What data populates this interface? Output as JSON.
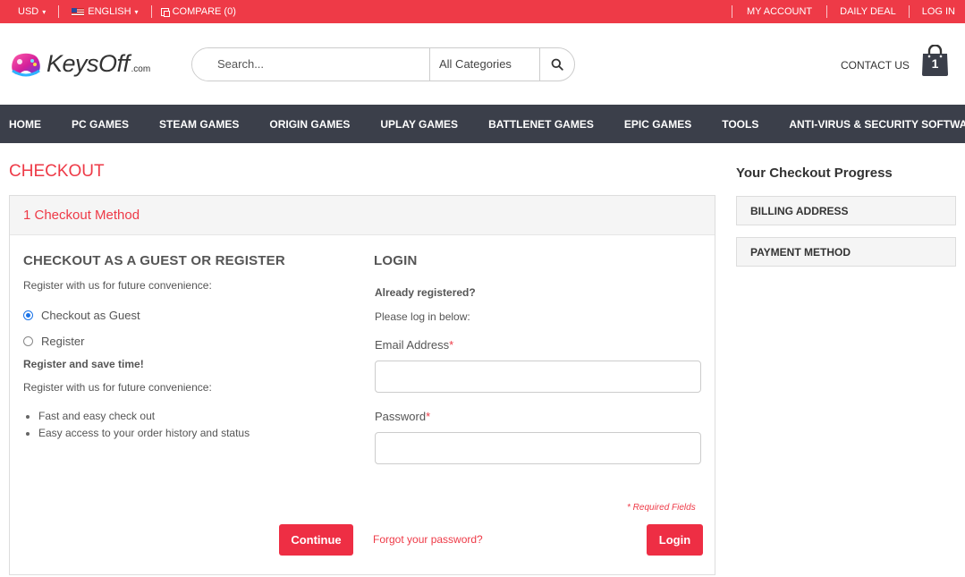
{
  "topbar": {
    "currency": "USD",
    "language": "ENGLISH",
    "compare": "COMPARE (0)",
    "my_account": "MY ACCOUNT",
    "daily_deal": "DAILY DEAL",
    "login": "LOG IN"
  },
  "header": {
    "logo_text": "KeysOff",
    "logo_suffix": ".com",
    "search_placeholder": "Search...",
    "search_category": "All Categories",
    "contact": "CONTACT US",
    "cart_count": "1"
  },
  "nav": {
    "items": [
      "HOME",
      "PC GAMES",
      "STEAM GAMES",
      "ORIGIN GAMES",
      "UPLAY GAMES",
      "BATTLENET GAMES",
      "EPIC GAMES",
      "TOOLS",
      "ANTI-VIRUS & SECURITY SOFTWARE"
    ]
  },
  "checkout": {
    "title": "CHECKOUT",
    "step_title": "1 Checkout Method",
    "guest": {
      "heading": "CHECKOUT AS A GUEST OR REGISTER",
      "intro": "Register with us for future convenience:",
      "option_guest": "Checkout as Guest",
      "option_register": "Register",
      "save_time": "Register and save time!",
      "convenience": "Register with us for future convenience:",
      "benefits": [
        "Fast and easy check out",
        "Easy access to your order history and status"
      ],
      "continue_label": "Continue"
    },
    "login": {
      "heading": "LOGIN",
      "already": "Already registered?",
      "please": "Please log in below:",
      "email_label": "Email Address",
      "password_label": "Password",
      "required_star": "*",
      "required_note": "* Required Fields",
      "forgot": "Forgot your password?",
      "login_label": "Login"
    }
  },
  "sidebar": {
    "title": "Your Checkout Progress",
    "items": [
      "BILLING ADDRESS",
      "PAYMENT METHOD"
    ]
  },
  "colors": {
    "accent": "#ee3a47",
    "nav_bg": "#3b3f4a"
  }
}
